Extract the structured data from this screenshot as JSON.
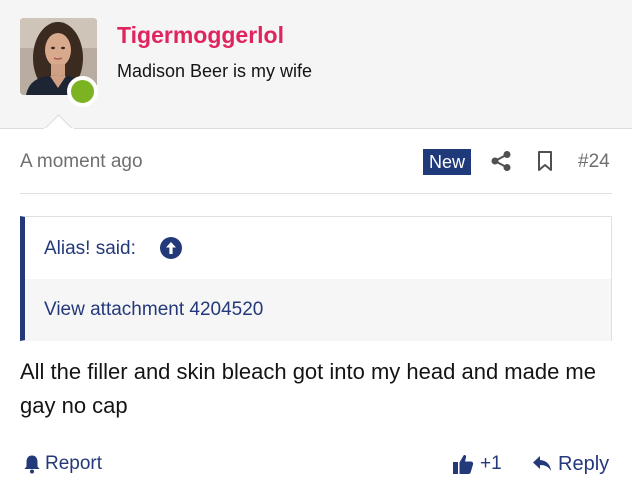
{
  "post": {
    "username": "Tigermoggerlol",
    "user_title": "Madison Beer is my wife",
    "avatar_icon": "user-avatar-photo",
    "online": true,
    "timestamp": "A moment ago",
    "new_badge": "New",
    "post_number": "#24",
    "quote": {
      "author_label": "Alias! said:",
      "attachment_text": "View attachment 4204520"
    },
    "body": "All the filler and skin bleach got into my head and made me gay no cap"
  },
  "actions": {
    "report_label": "Report",
    "like_label": "+1",
    "reply_label": "Reply",
    "share_icon": "share-icon",
    "bookmark_icon": "bookmark-icon"
  },
  "colors": {
    "username": "#e0245e",
    "link": "#24397a",
    "online": "#7bb322",
    "badge_bg": "#1f3a7a"
  }
}
